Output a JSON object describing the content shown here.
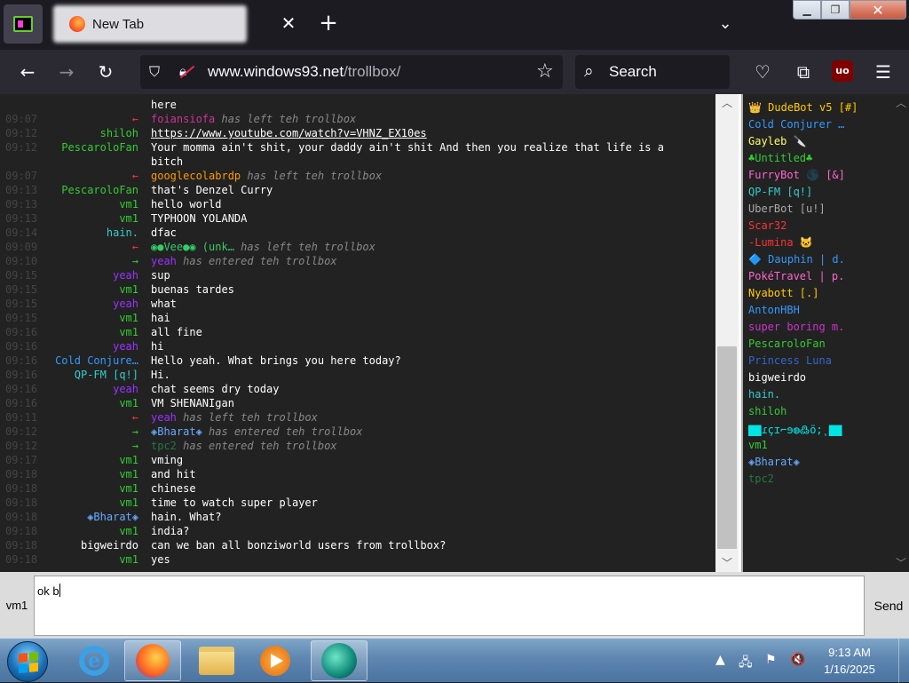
{
  "browser": {
    "tab_title": "New Tab",
    "url_domain": "www.windows93.net",
    "url_path": "/trollbox/",
    "search_placeholder": "Search"
  },
  "colors": {
    "chat_bg": "#222222",
    "time": "#444444",
    "leave": "#ff3333",
    "enter": "#33cc33"
  },
  "chat": {
    "messages": [
      {
        "time": "",
        "nick": "",
        "nick_color": "#ffffff",
        "text": "here",
        "type": "msg"
      },
      {
        "time": "09:07",
        "nick": "←",
        "nick_color": "#ff3333",
        "sysnick": "foiansiofa",
        "sysnick_color": "#cc3399",
        "text": " has left teh trollbox",
        "type": "sys"
      },
      {
        "time": "09:12",
        "nick": "shiloh",
        "nick_color": "#33cc33",
        "text": "https://www.youtube.com/watch?v=VHNZ_EX10es",
        "type": "link"
      },
      {
        "time": "09:12",
        "nick": "PescaroloFan",
        "nick_color": "#33cc33",
        "text": "Your momma ain't shit, your daddy ain't shit And then you realize that life is a bitch",
        "type": "wrap"
      },
      {
        "time": "09:07",
        "nick": "←",
        "nick_color": "#ff3333",
        "sysnick": "googlecolabrdp",
        "sysnick_color": "#ff9900",
        "text": " has left teh trollbox",
        "type": "sys"
      },
      {
        "time": "09:13",
        "nick": "PescaroloFan",
        "nick_color": "#33cc33",
        "text": "that's Denzel Curry",
        "type": "msg"
      },
      {
        "time": "09:13",
        "nick": "vm1",
        "nick_color": "#33cc33",
        "text": "hello world",
        "type": "msg"
      },
      {
        "time": "09:13",
        "nick": "vm1",
        "nick_color": "#33cc33",
        "text": "TYPHOON YOLANDA",
        "type": "msg"
      },
      {
        "time": "09:14",
        "nick": "hain.",
        "nick_color": "#33cccc",
        "text": "dfac",
        "type": "msg"
      },
      {
        "time": "09:09",
        "nick": "←",
        "nick_color": "#ff3333",
        "sysnick": "◉●Vee●◉ (unk…",
        "sysnick_color": "#33cc66",
        "text": " has left teh trollbox",
        "type": "sys"
      },
      {
        "time": "09:10",
        "nick": "→",
        "nick_color": "#33cc33",
        "sysnick": "yeah",
        "sysnick_color": "#9933ff",
        "text": " has entered teh trollbox",
        "type": "sys"
      },
      {
        "time": "09:15",
        "nick": "yeah",
        "nick_color": "#9933ff",
        "text": "sup",
        "type": "msg"
      },
      {
        "time": "09:15",
        "nick": "vm1",
        "nick_color": "#33cc33",
        "text": "buenas tardes",
        "type": "msg"
      },
      {
        "time": "09:15",
        "nick": "yeah",
        "nick_color": "#9933ff",
        "text": "what",
        "type": "msg"
      },
      {
        "time": "09:15",
        "nick": "vm1",
        "nick_color": "#33cc33",
        "text": "hai",
        "type": "msg"
      },
      {
        "time": "09:16",
        "nick": "vm1",
        "nick_color": "#33cc33",
        "text": "all fine",
        "type": "msg"
      },
      {
        "time": "09:16",
        "nick": "yeah",
        "nick_color": "#9933ff",
        "text": "hi",
        "type": "msg"
      },
      {
        "time": "09:16",
        "nick": "Cold Conjure…",
        "nick_color": "#3399ff",
        "text": "Hello yeah. What brings you here today?",
        "type": "msg"
      },
      {
        "time": "09:16",
        "nick": "QP-FM [q!]",
        "nick_color": "#33cccc",
        "text": "Hi.",
        "type": "msg"
      },
      {
        "time": "09:16",
        "nick": "yeah",
        "nick_color": "#9933ff",
        "text": "chat seems dry today",
        "type": "msg"
      },
      {
        "time": "09:16",
        "nick": "vm1",
        "nick_color": "#33cc33",
        "text": "VM SHENANIgan",
        "type": "msg"
      },
      {
        "time": "09:11",
        "nick": "←",
        "nick_color": "#ff3333",
        "sysnick": "yeah",
        "sysnick_color": "#9933ff",
        "text": " has left teh trollbox",
        "type": "sys"
      },
      {
        "time": "09:12",
        "nick": "→",
        "nick_color": "#33cc33",
        "sysnick": "◈Bharat◈",
        "sysnick_color": "#66aaff",
        "text": " has entered teh trollbox",
        "type": "sys"
      },
      {
        "time": "09:12",
        "nick": "→",
        "nick_color": "#33cc33",
        "sysnick": "tpc2",
        "sysnick_color": "#227744",
        "text": " has entered teh trollbox",
        "type": "sys"
      },
      {
        "time": "09:17",
        "nick": "vm1",
        "nick_color": "#33cc33",
        "text": "vming",
        "type": "msg"
      },
      {
        "time": "09:18",
        "nick": "vm1",
        "nick_color": "#33cc33",
        "text": "and hit",
        "type": "msg"
      },
      {
        "time": "09:18",
        "nick": "vm1",
        "nick_color": "#33cc33",
        "text": "chinese",
        "type": "msg"
      },
      {
        "time": "09:18",
        "nick": "vm1",
        "nick_color": "#33cc33",
        "text": "time to watch super player",
        "type": "msg"
      },
      {
        "time": "09:18",
        "nick": "◈Bharat◈",
        "nick_color": "#66aaff",
        "text": "hain. What?",
        "type": "msg"
      },
      {
        "time": "09:18",
        "nick": "vm1",
        "nick_color": "#33cc33",
        "text": "india?",
        "type": "msg"
      },
      {
        "time": "09:18",
        "nick": "bigweirdo",
        "nick_color": "#ffffff",
        "text": "can we ban all bonziworld users from trollbox?",
        "type": "msg"
      },
      {
        "time": "09:18",
        "nick": "vm1",
        "nick_color": "#33cc33",
        "text": "yes",
        "type": "msg"
      }
    ]
  },
  "users": [
    {
      "name": "👑 DudeBot v5 [#]",
      "color": "#ffcc00"
    },
    {
      "name": "Cold Conjurer …",
      "color": "#3399ff"
    },
    {
      "name": "Gayleb 🔪",
      "color": "#ffff66"
    },
    {
      "name": "♣Untitled♣",
      "color": "#33cc33"
    },
    {
      "name": "FurryBot 🌑 [&]",
      "color": "#ff66cc"
    },
    {
      "name": "QP-FM [q!]",
      "color": "#33cccc"
    },
    {
      "name": "UberBot [u!]",
      "color": "#aaaaaa"
    },
    {
      "name": "Scar32",
      "color": "#ff3333"
    },
    {
      "name": "-Lumina 🐱",
      "color": "#ff3333"
    },
    {
      "name": "🔷 Dauphin | d.",
      "color": "#3399ff"
    },
    {
      "name": "PokéTravel | p.",
      "color": "#ff66cc"
    },
    {
      "name": "Nyabott [.]",
      "color": "#ffcc00"
    },
    {
      "name": "AntonHBH",
      "color": "#3399ff"
    },
    {
      "name": "super boring m.",
      "color": "#cc33cc"
    },
    {
      "name": "PescaroloFan",
      "color": "#33cc33"
    },
    {
      "name": "Princess Luna",
      "color": "#3366cc"
    },
    {
      "name": "bigweirdo",
      "color": "#ffffff"
    },
    {
      "name": "hain.",
      "color": "#33cccc"
    },
    {
      "name": "shiloh",
      "color": "#33cc33"
    },
    {
      "name": "▇▇ɾçɪ⌐ɘ◍߷ö;˛▇▇",
      "color": "#00e5e5"
    },
    {
      "name": "vm1",
      "color": "#33cc33"
    },
    {
      "name": "◈Bharat◈",
      "color": "#66aaff"
    },
    {
      "name": "tpc2",
      "color": "#227744"
    }
  ],
  "input": {
    "nick_label": "vm1",
    "value": "ok b",
    "send_label": "Send"
  },
  "taskbar": {
    "time": "9:13 AM",
    "date": "1/16/2025"
  }
}
